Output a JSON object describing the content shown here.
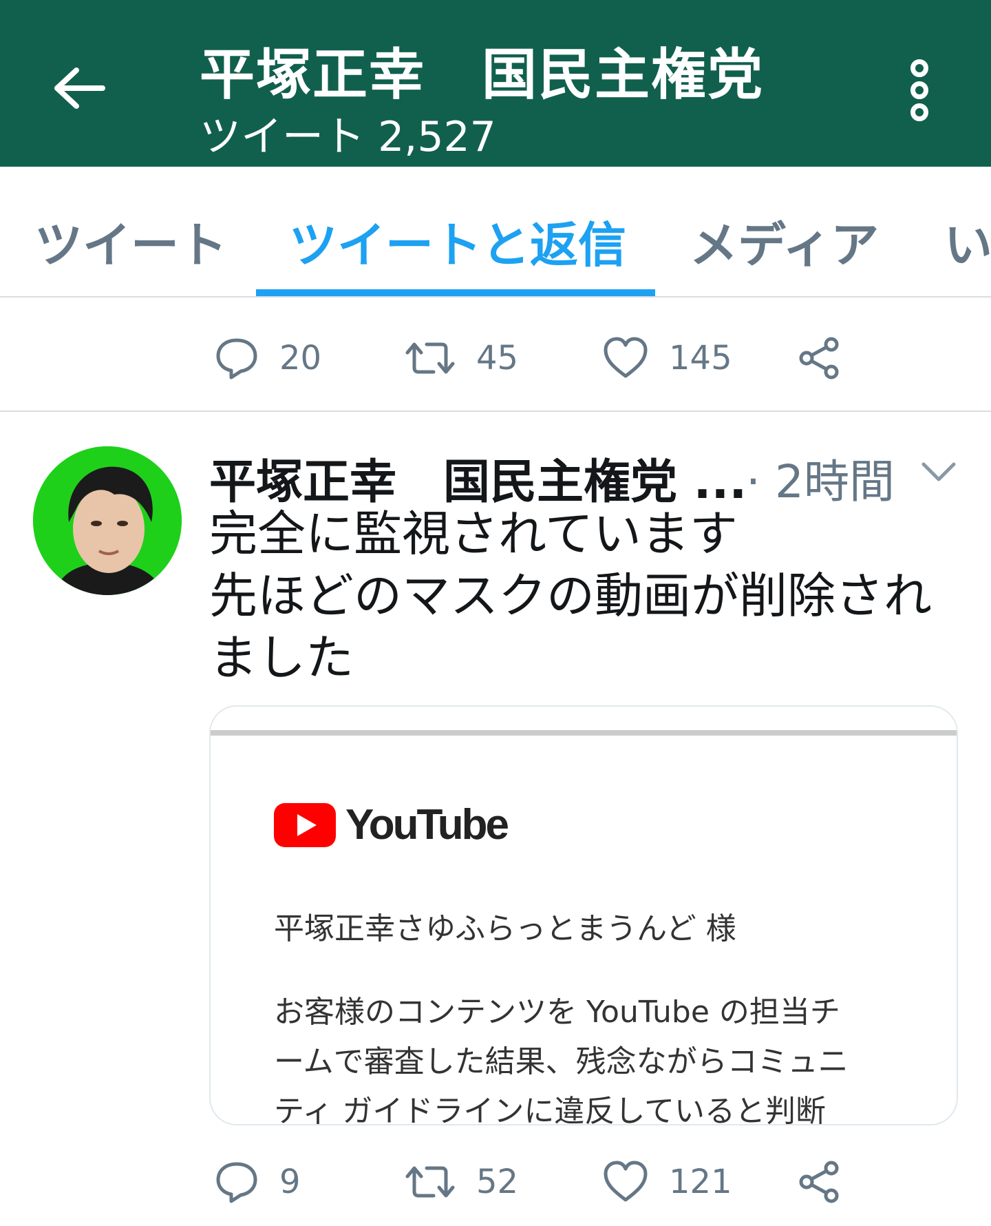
{
  "header": {
    "title": "平塚正幸　国民主権党",
    "subtitle": "ツイート 2,527"
  },
  "tabs": [
    {
      "label": "ツイート"
    },
    {
      "label": "ツイートと返信"
    },
    {
      "label": "メディア"
    },
    {
      "label": "い"
    }
  ],
  "tweet1_actions": {
    "replies": "20",
    "retweets": "45",
    "likes": "145"
  },
  "tweet2": {
    "name": "平塚正幸　国民主権党 ...",
    "time": "· 2時間",
    "text_lines": [
      "完全に監視されています",
      "先ほどのマスクの動画が削除され",
      "ました"
    ],
    "card": {
      "logo_text": "YouTube",
      "greeting": "平塚正幸さゆふらっとまうんど 様",
      "body_lines": [
        "お客様のコンテンツを YouTube の担当チ",
        "ームで審査した結果、残念ながらコミュニ",
        "ティ ガイドラインに違反していると判断"
      ]
    },
    "actions": {
      "replies": "9",
      "retweets": "52",
      "likes": "121"
    }
  },
  "colors": {
    "header_bg": "#11604e",
    "accent": "#1da1f2",
    "muted": "#657786",
    "avatar_bg": "#1ed01a",
    "youtube_red": "#ff0000"
  },
  "icons": [
    "back-arrow-icon",
    "more-vertical-icon",
    "reply-icon",
    "retweet-icon",
    "like-icon",
    "share-icon",
    "chevron-down-icon",
    "youtube-logo-icon"
  ]
}
